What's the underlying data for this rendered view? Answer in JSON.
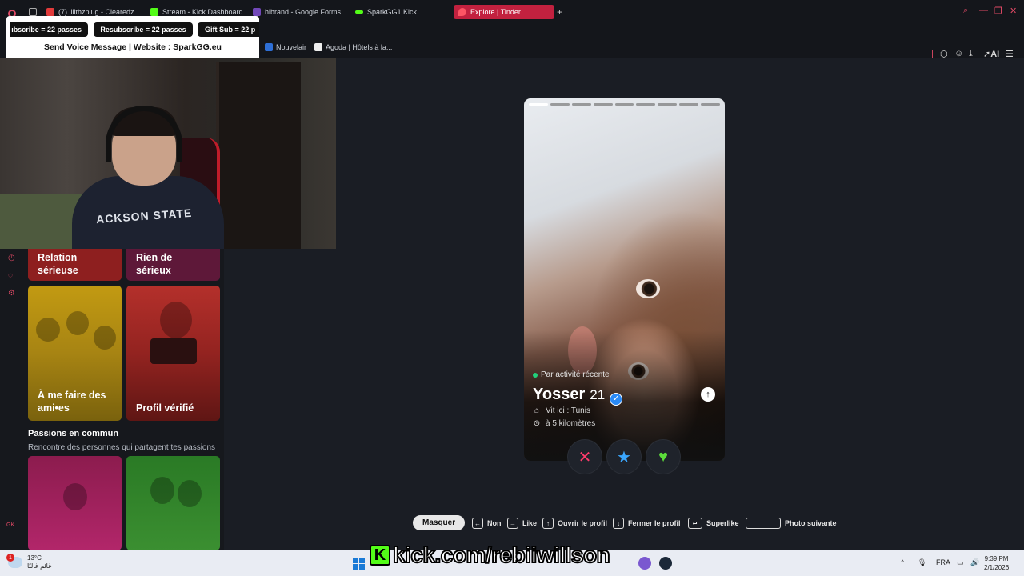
{
  "browser": {
    "tabs": [
      {
        "label": "(7) lilithzplug - Clearedz...",
        "color": "#e23b3b"
      },
      {
        "label": "Stream - Kick Dashboard",
        "color": "#53fc18"
      },
      {
        "label": "hibrand - Google Forms",
        "color": "#7248b9"
      },
      {
        "label": "SparkGG1 Kick",
        "color": "#53fc18"
      },
      {
        "label": "Explore | Tinder",
        "color": "#fd5564",
        "active": true
      }
    ],
    "new_tab": "+",
    "bookmarks": [
      {
        "label": "Nouvelair"
      },
      {
        "label": "Agoda | Hôtels à la..."
      }
    ],
    "ai_label": "AI"
  },
  "overlay": {
    "pills": [
      "ıbscribe = 22 passes",
      "Resubscribe = 22 passes",
      "Gift Sub = 22 p"
    ],
    "voice_line": "Send Voice Message | Website : SparkGG.eu"
  },
  "webcam": {
    "hoodie_text": "ACKSON STATE"
  },
  "sidebar": {
    "cards_top": [
      {
        "label": "Relation sérieuse"
      },
      {
        "label": "Rien de sérieux"
      }
    ],
    "card_friends": "À me faire des ami•es",
    "card_verified": "Profil vérifié",
    "section_title": "Passions en commun",
    "section_subtitle": "Rencontre des personnes qui partagent tes passions",
    "rail_text": "GK"
  },
  "profile": {
    "activity": "Par activité récente",
    "name": "Yosser",
    "age": "21",
    "lives": "Vit ici : Tunis",
    "distance": "à 5 kilomètres",
    "photo_count": 9,
    "current_photo": 1
  },
  "actions": {
    "nope": "✕",
    "superlike": "★",
    "like": "♥"
  },
  "hints": {
    "masquer": "Masquer",
    "non": "Non",
    "like": "Like",
    "open": "Ouvrir le profil",
    "close": "Fermer le profil",
    "superlike": "Superlike",
    "next_photo": "Photo suivante"
  },
  "stream_overlay": {
    "kick_letter": "K",
    "kick_url": "kick.com/rebiiwillson"
  },
  "taskbar": {
    "weather_badge": "1",
    "temperature": "13°C",
    "weather_text": "غائم غالبًا",
    "lang": "FRA",
    "time": "9:39 PM",
    "date": "2/1/2026"
  }
}
